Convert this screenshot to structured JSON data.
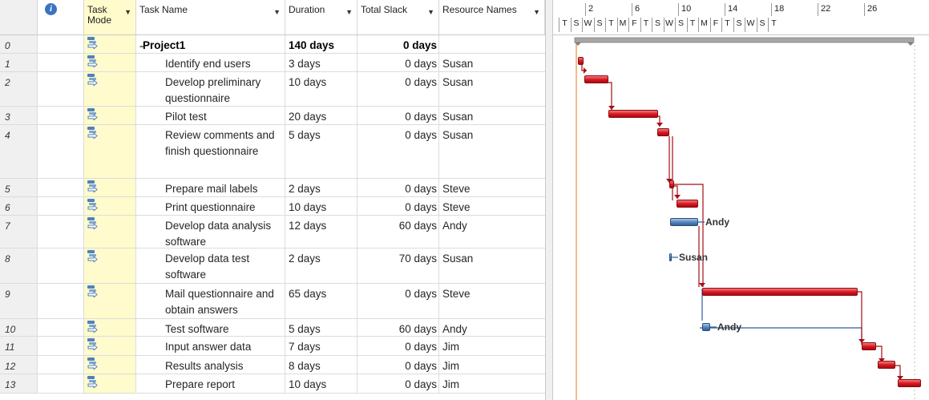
{
  "columns": {
    "info_icon": "i",
    "task_mode": "Task Mode",
    "task_name": "Task Name",
    "duration": "Duration",
    "total_slack": "Total Slack",
    "resource_names": "Resource Names"
  },
  "summary_toggle": "−",
  "tasks": [
    {
      "id": "0",
      "name": "Project1",
      "duration": "140 days",
      "slack": "0 days",
      "resource": ""
    },
    {
      "id": "1",
      "name": "Identify end users",
      "duration": "3 days",
      "slack": "0 days",
      "resource": "Susan"
    },
    {
      "id": "2",
      "name": "Develop preliminary questionnaire",
      "duration": "10 days",
      "slack": "0 days",
      "resource": "Susan"
    },
    {
      "id": "3",
      "name": "Pilot test",
      "duration": "20 days",
      "slack": "0 days",
      "resource": "Susan"
    },
    {
      "id": "4",
      "name": "Review comments and finish questionnaire",
      "duration": "5 days",
      "slack": "0 days",
      "resource": "Susan"
    },
    {
      "id": "5",
      "name": "Prepare mail labels",
      "duration": "2 days",
      "slack": "0 days",
      "resource": "Steve"
    },
    {
      "id": "6",
      "name": "Print questionnaire",
      "duration": "10 days",
      "slack": "0 days",
      "resource": "Steve"
    },
    {
      "id": "7",
      "name": "Develop data analysis software",
      "duration": "12 days",
      "slack": "60 days",
      "resource": "Andy"
    },
    {
      "id": "8",
      "name": "Develop data test software",
      "duration": "2 days",
      "slack": "70 days",
      "resource": "Susan"
    },
    {
      "id": "9",
      "name": "Mail questionnaire and obtain answers",
      "duration": "65 days",
      "slack": "0 days",
      "resource": "Steve"
    },
    {
      "id": "10",
      "name": "Test software",
      "duration": "5 days",
      "slack": "60 days",
      "resource": "Andy"
    },
    {
      "id": "11",
      "name": "Input answer data",
      "duration": "7 days",
      "slack": "0 days",
      "resource": "Jim"
    },
    {
      "id": "12",
      "name": "Results analysis",
      "duration": "8 days",
      "slack": "0 days",
      "resource": "Jim"
    },
    {
      "id": "13",
      "name": "Prepare report",
      "duration": "10 days",
      "slack": "0 days",
      "resource": "Jim"
    }
  ],
  "timescale": {
    "weeks": [
      "2",
      "6",
      "10",
      "14",
      "18",
      "22",
      "26"
    ],
    "days": [
      "T",
      "S",
      "W",
      "S",
      "T",
      "M",
      "F",
      "T",
      "S",
      "W",
      "S",
      "T",
      "M",
      "F",
      "T",
      "S",
      "W",
      "S",
      "T"
    ]
  },
  "gantt_labels": {
    "task7": "Andy",
    "task8": "Susan",
    "task10": "Andy"
  },
  "colors": {
    "critical_bar": "#d9141f",
    "noncritical_bar": "#4f81bd",
    "link_critical": "#a50d14",
    "link_noncritical": "#2e5c9a",
    "today_line": "#f4a460",
    "task_mode_bg": "#fffbcc"
  }
}
